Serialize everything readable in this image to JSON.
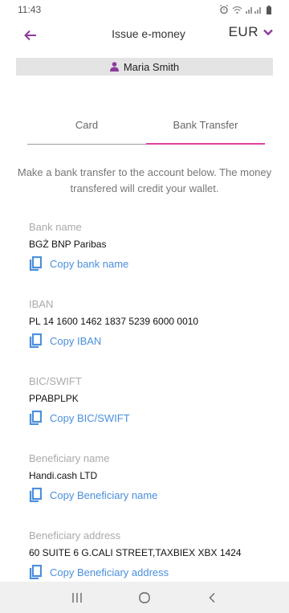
{
  "status_bar": {
    "time": "11:43"
  },
  "app_bar": {
    "title": "Issue e-money",
    "currency": "EUR"
  },
  "user": {
    "name": "Maria Smith"
  },
  "tabs": [
    {
      "label": "Card",
      "active": false
    },
    {
      "label": "Bank Transfer",
      "active": true
    }
  ],
  "instructions": "Make a bank transfer to the account below. The money transfered will credit your wallet.",
  "fields": {
    "bank_name": {
      "label": "Bank name",
      "value": "BGŻ BNP Paribas",
      "copy_label": "Copy bank name"
    },
    "iban": {
      "label": "IBAN",
      "value": "PL 14 1600 1462 1837 5239 6000 0010",
      "copy_label": "Copy IBAN"
    },
    "bic": {
      "label": "BIC/SWIFT",
      "value": "PPABPLPK",
      "copy_label": "Copy BIC/SWIFT"
    },
    "beneficiary_name": {
      "label": "Beneficiary name",
      "value": "Handi.cash LTD",
      "copy_label": "Copy Beneficiary name"
    },
    "beneficiary_address": {
      "label": "Beneficiary address",
      "value": "60 SUITE 6 G.CALI STREET,TAXBIEX XBX 1424",
      "copy_label": "Copy Beneficiary address"
    }
  },
  "colors": {
    "accent": "#e040a0",
    "back_arrow": "#8e3a9c",
    "link": "#4a8fdc"
  },
  "icons": {
    "back": "arrow-left-icon",
    "currency_dropdown": "chevron-down-icon",
    "user": "person-icon",
    "copy": "copy-icon",
    "nav_recents": "recents-icon",
    "nav_home": "home-icon",
    "nav_back": "back-icon"
  }
}
